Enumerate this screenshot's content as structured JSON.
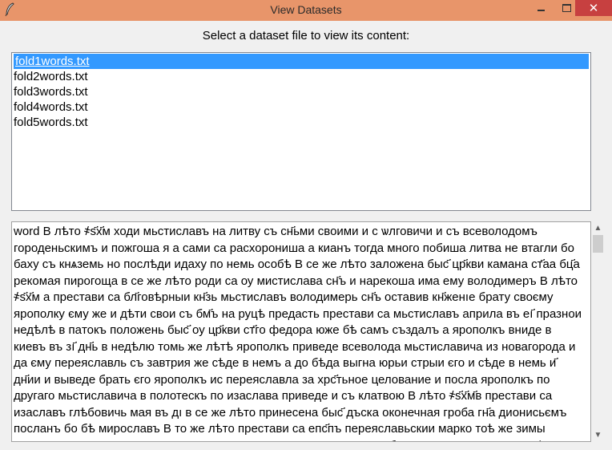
{
  "window": {
    "title": "View Datasets",
    "close_glyph": "✕",
    "titlebar_color": "#e8956a"
  },
  "prompt": "Select a dataset file to view its content:",
  "files": [
    {
      "name": "fold1words.txt",
      "selected": true
    },
    {
      "name": "fold2words.txt",
      "selected": false
    },
    {
      "name": "fold3words.txt",
      "selected": false
    },
    {
      "name": "fold4words.txt",
      "selected": false
    },
    {
      "name": "fold5words.txt",
      "selected": false
    }
  ],
  "content": "word В лѣто ҂ѕ҃х҃м ходи мьстиславъ на литву съ сн҃ьми своими и с ѡлговичи и съ всеволодомъ городеньскимъ и пожгоша я а сами са расхорониша а кианъ тогда много побиша литва не втагли бо баху съ кнѧземь но послѣди идаху по немь особѣ В се же лѣто заложена быс҃ цр҃кви камана ст҃аа бц҃а рекомая пирогоща в се же лѣто роди са оу мистислава сн҃ъ и нарекоша има ему володимеръ В лѣто ҂ѕ҃х҃м а престави са бл҃говѣрныи кн҃зь мьстиславъ володимерь сн҃ъ оставив кн҃женıе брату своєму ярополку єму же и дѣти свои съ бм҃ъ на руцѣ предасть престави са мьстиславъ априла въ еı҃ празнои недѣлѣ в пaтокъ положень быс҃ оу цр҃кви ст҃го федора юже бѣ самъ създалъ а ярополкъ вниде в киевъ въ зı҃ дн҃ь в недѣлю томь же лѣтѣ ярополкъ приведе всеволода мьстиславича из новагорода и да єму переяславль съ завтрия же сѣде в немъ а до бѣда выгна юрьи стрыи єго и сѣде в немь и҃ дн҃ии и выведе брать єго ярополкъ ис переяславла за хрс҃тьное целование и посла ярополкъ по другаго мьстиславича в полотескъ по изаслава приведе и съ клатвою В лѣто ҂ѕ҃х҃м҃в престави са изаславъ глѣбовичь мая въ дı в се же лѣто принесена быс҃ дъска оконечная гроба гн҃а дионисьємъ посланъ бо бѣ мирославъ В то же лѣто престави са епс҃пъ переяславьскии марко тоѣ же зимы вачьславъ пишив са переяславла иде wпать турову не послушавъ брата своєго ярополка В лѣто ҂ѕ҃х҃м г юрьи испроси оу брата своєго ярополка переяславль а ярополку дасть суждаль и"
}
